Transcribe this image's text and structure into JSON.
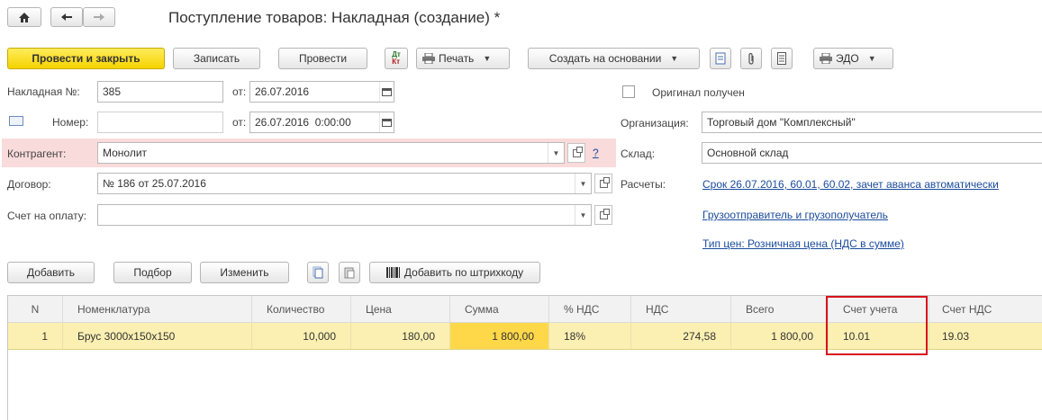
{
  "window": {
    "title": "Поступление товаров: Накладная (создание) *"
  },
  "toolbar": {
    "post_and_close": "Провести и закрыть",
    "save": "Записать",
    "post": "Провести",
    "print": "Печать",
    "create_based_on": "Создать на основании",
    "edo": "ЭДО"
  },
  "form": {
    "invoice_no_label": "Накладная №:",
    "invoice_no": "385",
    "from_label_1": "от:",
    "invoice_date": "26.07.2016",
    "number_label": "Номер:",
    "number_value": "",
    "from_label_2": "от:",
    "number_datetime": "26.07.2016  0:00:00",
    "counterparty_label": "Контрагент:",
    "counterparty": "Монолит",
    "help_mark": "?",
    "contract_label": "Договор:",
    "contract": "№ 186 от 25.07.2016",
    "payment_invoice_label": "Счет на оплату:",
    "payment_invoice": "",
    "original_received_label": "Оригинал получен",
    "organization_label": "Организация:",
    "organization": "Торговый дом \"Комплексный\"",
    "warehouse_label": "Склад:",
    "warehouse": "Основной склад",
    "settlements_label": "Расчеты:",
    "settlements_link": "Срок 26.07.2016, 60.01, 60.02, зачет аванса автоматически",
    "shipper_link": "Грузоотправитель и грузополучатель",
    "price_type_link": "Тип цен: Розничная цена (НДС в сумме)"
  },
  "table_toolbar": {
    "add": "Добавить",
    "pick": "Подбор",
    "edit": "Изменить",
    "add_by_barcode": "Добавить по штрихкоду"
  },
  "table": {
    "columns": [
      "N",
      "Номенклатура",
      "Количество",
      "Цена",
      "Сумма",
      "% НДС",
      "НДС",
      "Всего",
      "Счет учета",
      "Счет НДС"
    ],
    "rows": [
      [
        "1",
        "Брус 3000х150х150",
        "10,000",
        "180,00",
        "1 800,00",
        "18%",
        "274,58",
        "1 800,00",
        "10.01",
        "19.03"
      ]
    ]
  },
  "colors": {
    "accent_yellow": "#f5d300",
    "selected_row": "#fbf0b2",
    "active_cell": "#ffd84a",
    "highlight_box": "#d9121b",
    "error_field_bg": "#fadbdb",
    "link": "#1a4b9c"
  }
}
